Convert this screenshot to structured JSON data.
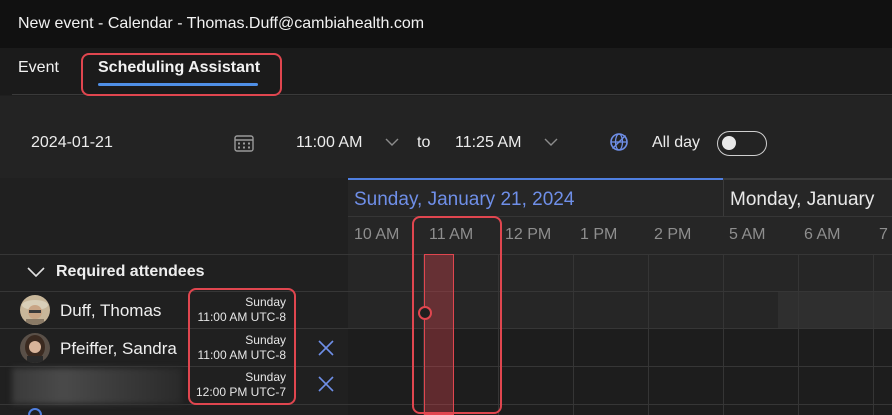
{
  "window": {
    "title": "New event - Calendar - Thomas.Duff@cambiahealth.com"
  },
  "tabs": [
    {
      "label": "Event",
      "active": false
    },
    {
      "label": "Scheduling Assistant",
      "active": true
    }
  ],
  "toolbar": {
    "date": "2024-01-21",
    "start_time": "11:00 AM",
    "to_label": "to",
    "end_time": "11:25 AM",
    "allday_label": "All day",
    "allday_on": false,
    "icons": [
      "calendar-icon",
      "chevron-down-icon",
      "timezone-globe-icon"
    ]
  },
  "grid": {
    "days": [
      "Sunday, January 21, 2024",
      "Monday, January"
    ],
    "hours": [
      "10 AM",
      "11 AM",
      "12 PM",
      "1 PM",
      "2 PM",
      "5 AM",
      "6 AM",
      "7"
    ]
  },
  "attendees": {
    "section_label": "Required attendees",
    "people": [
      {
        "name": "Duff, Thomas",
        "tz_day": "Sunday",
        "tz_time": "11:00 AM UTC-8",
        "removable": false
      },
      {
        "name": "Pfeiffer, Sandra",
        "tz_day": "Sunday",
        "tz_time": "11:00 AM UTC-8",
        "removable": true
      },
      {
        "name": "",
        "tz_day": "Sunday",
        "tz_time": "12:00 PM UTC-7",
        "removable": true
      }
    ]
  },
  "colors": {
    "accent": "#4f7fe0",
    "highlight": "#e0464f",
    "background": "#1f1f1f"
  }
}
